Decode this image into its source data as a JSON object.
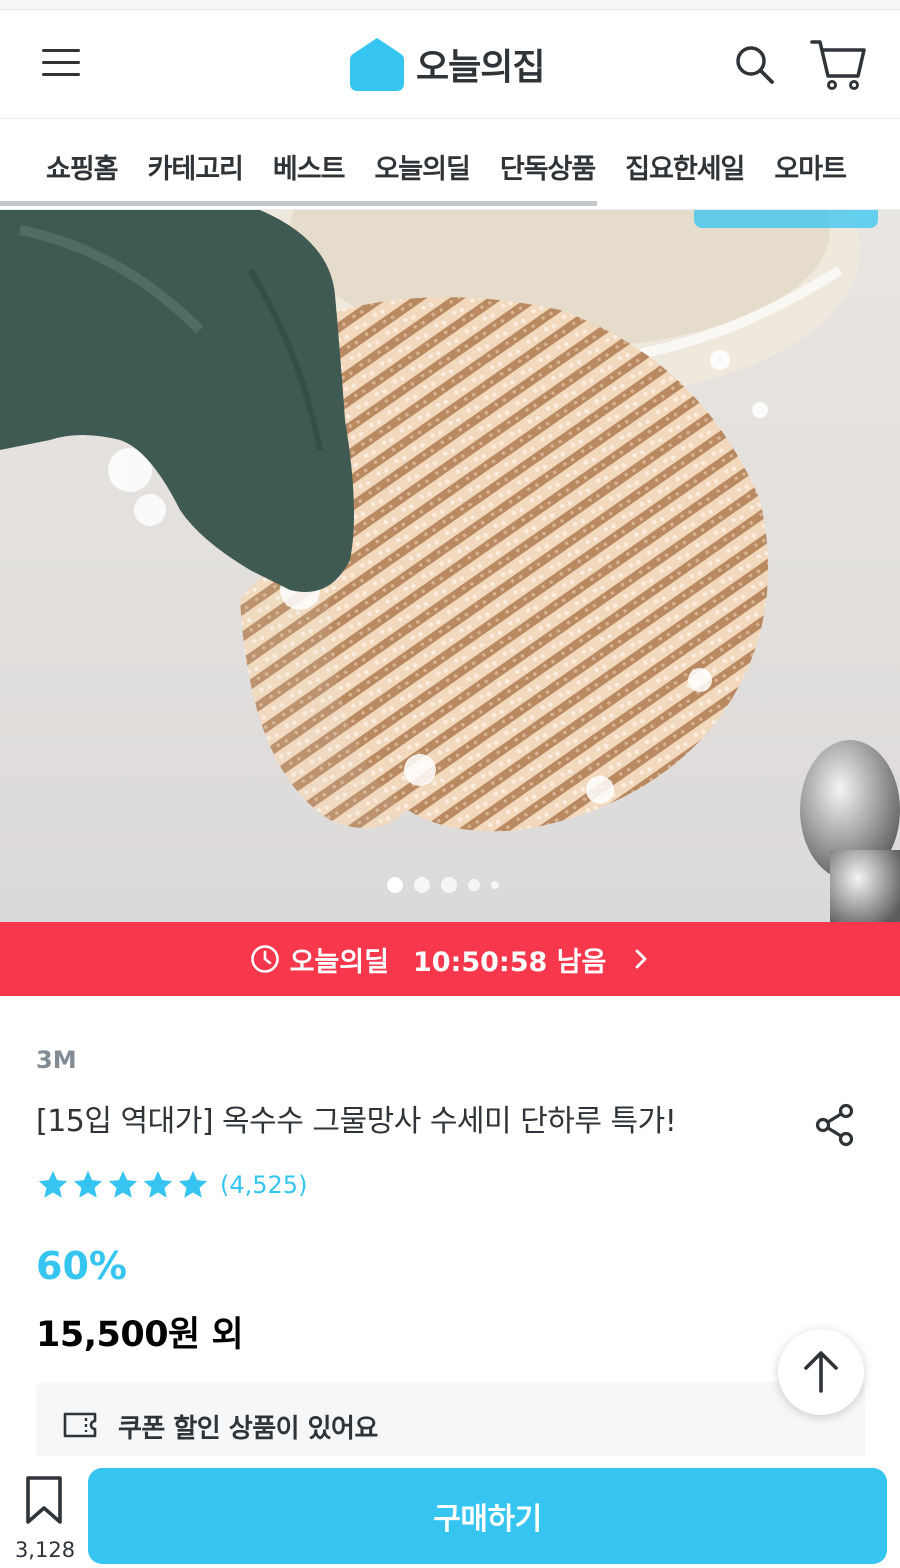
{
  "header": {
    "logo_text": "오늘의집",
    "brand_color": "#35c5f0",
    "menu_icon": "hamburger-menu-icon",
    "search_icon": "search-icon",
    "cart_icon": "cart-icon"
  },
  "nav": {
    "tabs": [
      "쇼핑홈",
      "카테고리",
      "베스트",
      "오늘의딜",
      "단독상품",
      "집요한세일",
      "오마트"
    ]
  },
  "gallery": {
    "image_description_icon": "product-photo-mesh-scrubber",
    "image_count": 5,
    "active_index": 0
  },
  "deal": {
    "label": "오늘의딜",
    "timer": "10:50:58 남음",
    "bg_color": "#f7374c",
    "clock_icon": "clock-icon",
    "chevron_icon": "chevron-right-icon"
  },
  "product": {
    "brand": "3M",
    "title": "[15입 역대가] 옥수수 그물망사 수세미 단하루 특가!",
    "rating_stars": 5,
    "review_count": "(4,525)",
    "discount": "60%",
    "price": "15,500원 외",
    "share_icon": "share-icon"
  },
  "coupon": {
    "text": "쿠폰 할인 상품이 있어요",
    "icon": "coupon-ticket-icon"
  },
  "bottom": {
    "bookmark_count": "3,128",
    "buy_label": "구매하기",
    "bookmark_icon": "bookmark-icon",
    "scroll_top_icon": "arrow-up-icon"
  }
}
